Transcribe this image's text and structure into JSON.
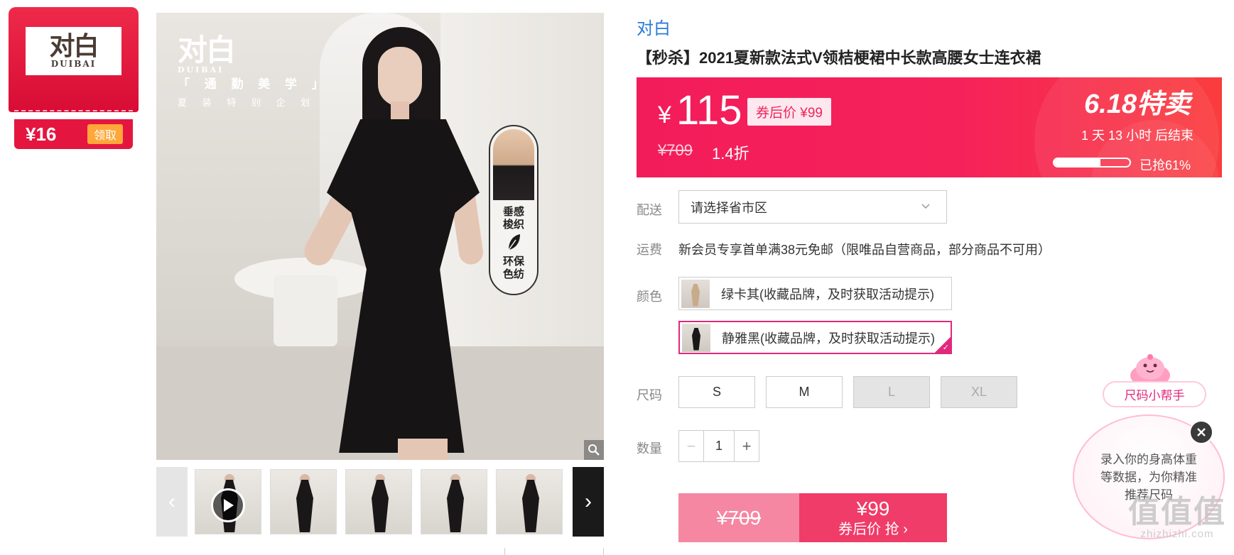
{
  "brand_card": {
    "logo_cn": "对白",
    "logo_en": "DUIBAI",
    "coupon_amount": "¥16",
    "claim_label": "领取"
  },
  "main_image": {
    "logo_cn": "对白",
    "logo_en": "DUIBAI",
    "tagline": "「 通 勤 美 学 」",
    "subtag": "夏 装 特 别 企 划",
    "feature_1": "垂感\n梭织",
    "feature_2": "环保\n色纺"
  },
  "thumbnails": {
    "prev_icon": "chevron-left-icon",
    "next_icon": "chevron-right-icon",
    "count": 5
  },
  "product": {
    "brand": "对白",
    "title": "【秒杀】2021夏新款法式V领桔梗裙中长款高腰女士连衣裙"
  },
  "price_banner": {
    "currency": "¥",
    "price": "115",
    "coupon_price": "券后价 ¥99",
    "original_price": "¥709",
    "discount": "1.4折",
    "sale_tag": "6.18特卖",
    "countdown": "1 天 13 小时 后结束",
    "sold_percent": 61,
    "sold_label": "已抢61%"
  },
  "delivery": {
    "label": "配送",
    "value": "请选择省市区"
  },
  "shipping": {
    "label": "运费",
    "text": "新会员专享首单满38元免邮（限唯品自营商品，部分商品不可用）"
  },
  "color": {
    "label": "颜色",
    "options": [
      {
        "label": "绿卡其(收藏品牌，及时获取活动提示)",
        "selected": false,
        "swatch": "#c9ab8c"
      },
      {
        "label": "静雅黑(收藏品牌，及时获取活动提示)",
        "selected": true,
        "swatch": "#1a1718"
      }
    ]
  },
  "size": {
    "label": "尺码",
    "options": [
      {
        "label": "S",
        "available": true
      },
      {
        "label": "M",
        "available": true
      },
      {
        "label": "L",
        "available": false
      },
      {
        "label": "XL",
        "available": false
      }
    ]
  },
  "quantity": {
    "label": "数量",
    "value": "1",
    "minus": "−",
    "plus": "+"
  },
  "buy": {
    "original_price": "¥709",
    "coupon_price": "¥99",
    "action_label": "券后价 抢 ›"
  },
  "size_helper": {
    "tag": "尺码小帮手",
    "message": "录入你的身高体重等数据，为你精准推荐尺码"
  },
  "watermark": {
    "cn": "值值值",
    "en": "zhizhizhi.com"
  },
  "colors": {
    "accent_pink": "#f21c5a",
    "brand_red": "#e4163f",
    "link_blue": "#2a7bd6",
    "select_border": "#e1287c"
  }
}
